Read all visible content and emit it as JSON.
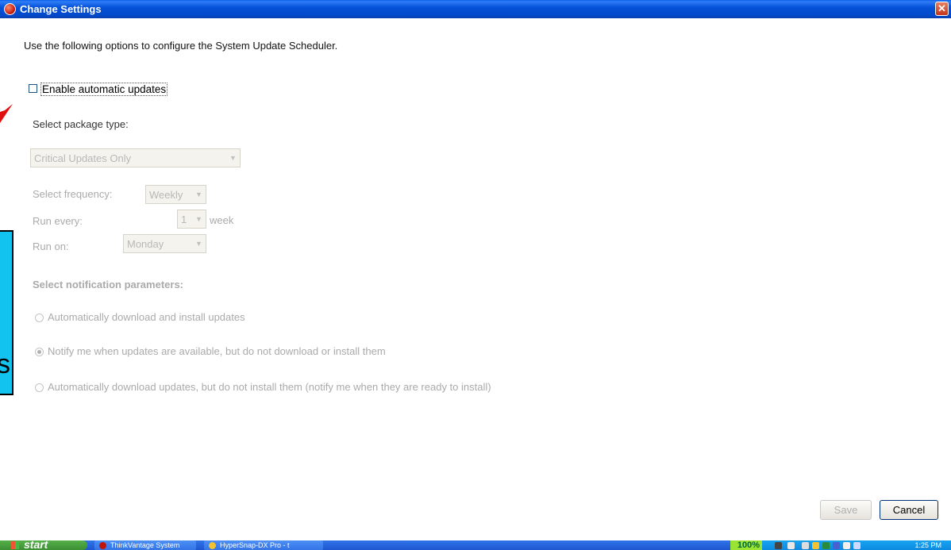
{
  "window": {
    "title": "Change Settings",
    "close_glyph": "✕"
  },
  "intro_text": "Use the following options to configure the System Update Scheduler.",
  "enable": {
    "label": "Enable automatic updates",
    "checked": false
  },
  "package": {
    "label": "Select package type:",
    "value": "Critical Updates Only"
  },
  "frequency": {
    "label": "Select frequency:",
    "value": "Weekly"
  },
  "run_every": {
    "label": "Run every:",
    "value": "1",
    "unit": "week"
  },
  "run_on": {
    "label": "Run on:",
    "value": "Monday"
  },
  "notification": {
    "heading": "Select notification parameters:",
    "options": [
      {
        "label": "Automatically download and install updates",
        "selected": false
      },
      {
        "label": "Notify me when updates are available, but do not download or install them",
        "selected": true
      },
      {
        "label": "Automatically download updates, but do not install them (notify me when they are ready to install)",
        "selected": false
      }
    ]
  },
  "buttons": {
    "save": "Save",
    "cancel": "Cancel"
  },
  "annotation": {
    "letter": "s"
  },
  "taskbar": {
    "start_label": "start",
    "items": [
      "ThinkVantage System",
      "HyperSnap-DX Pro - t"
    ],
    "zoom": "100%",
    "clock": "1:25 PM"
  },
  "colors": {
    "titlebar": "#0552d9",
    "annotation_box": "#12c3f0",
    "annotation_arrow": "#e01010"
  }
}
